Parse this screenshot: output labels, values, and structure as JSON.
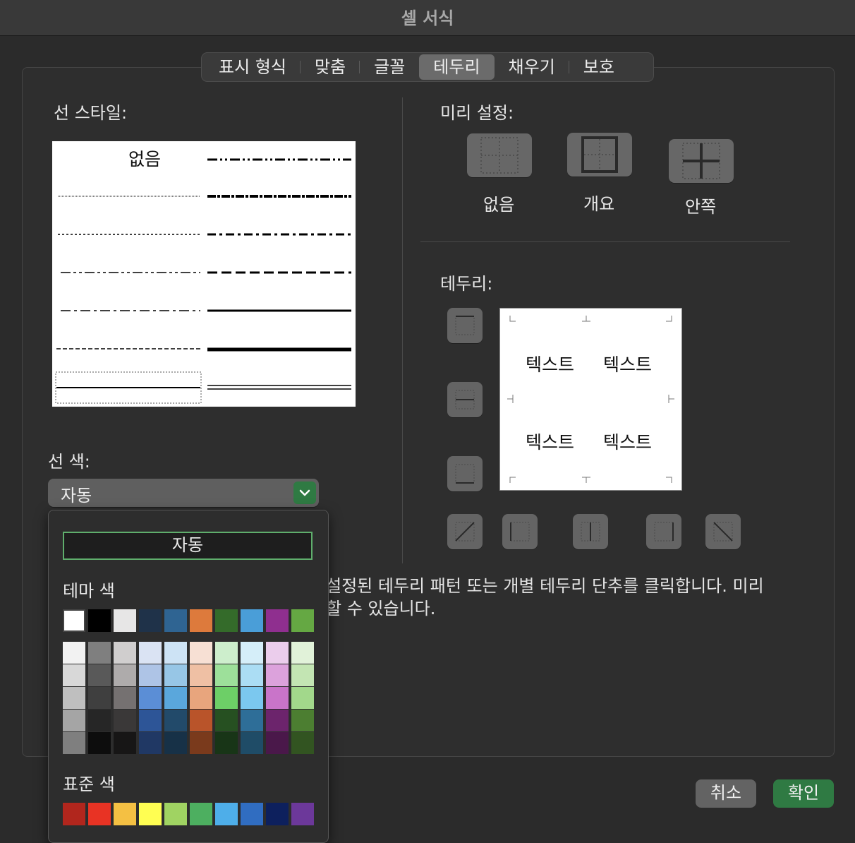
{
  "window": {
    "title": "셀 서식"
  },
  "tabs": [
    {
      "label": "표시 형식"
    },
    {
      "label": "맞춤"
    },
    {
      "label": "글꼴"
    },
    {
      "label": "테두리",
      "active": true
    },
    {
      "label": "채우기"
    },
    {
      "label": "보호"
    }
  ],
  "line_style": {
    "label": "선 스타일:",
    "none_label": "없음",
    "styles": [
      "none",
      "dash-dot-dot-medium",
      "hair",
      "slanted-dash-dot",
      "dotted",
      "dash-dot-medium",
      "dash-dot-dot",
      "dashed-medium",
      "dash-dot",
      "medium",
      "dashed",
      "thick",
      "thin-selected",
      "double"
    ],
    "selected": "thin"
  },
  "presets": {
    "label": "미리 설정:",
    "items": [
      {
        "label": "없음",
        "icon": "no-border-icon"
      },
      {
        "label": "개요",
        "icon": "outline-border-icon"
      },
      {
        "label": "안쪽",
        "icon": "inside-border-icon"
      }
    ]
  },
  "border": {
    "label": "테두리:",
    "preview_text": [
      "텍스트",
      "텍스트",
      "텍스트",
      "텍스트"
    ],
    "side_buttons": [
      "top-border-icon",
      "middle-horizontal-border-icon",
      "bottom-border-icon"
    ],
    "bottom_buttons": [
      "diagonal-up-border-icon",
      "left-border-icon",
      "middle-vertical-border-icon",
      "right-border-icon",
      "diagonal-down-border-icon"
    ]
  },
  "line_color": {
    "label": "선 색:",
    "value": "자동",
    "accent": "#2f7a43"
  },
  "color_popup": {
    "auto_label": "자동",
    "theme_label": "테마 색",
    "standard_label": "표준 색",
    "theme_top": [
      "#ffffff",
      "#000000",
      "#e7e6e6",
      "#1f3249",
      "#2f6492",
      "#dd7a3c",
      "#346b2a",
      "#4a9ed8",
      "#8f2f8f",
      "#65a843"
    ],
    "theme_shades": [
      [
        "#f2f2f2",
        "#d8d8d8",
        "#bfbfbf",
        "#a5a5a5",
        "#7f7f7f"
      ],
      [
        "#7f7f7f",
        "#595959",
        "#3f3f3f",
        "#262626",
        "#0d0d0d"
      ],
      [
        "#d0cece",
        "#aeabab",
        "#757171",
        "#3a3838",
        "#171616"
      ],
      [
        "#dae3f3",
        "#aec4e6",
        "#5b8ed6",
        "#2d5597",
        "#203864"
      ],
      [
        "#cde3f5",
        "#97c6e6",
        "#5aa7dc",
        "#224a6a",
        "#173147"
      ],
      [
        "#f7e0d4",
        "#efc0a4",
        "#e8a57d",
        "#b9542a",
        "#7a3a1c"
      ],
      [
        "#cdeecc",
        "#9de09a",
        "#6dcf67",
        "#265021",
        "#183517"
      ],
      [
        "#d5eef9",
        "#abddf4",
        "#7bc8ef",
        "#2e6e98",
        "#1f4c67"
      ],
      [
        "#ebcdec",
        "#dca2dc",
        "#c974c9",
        "#6c246c",
        "#4a184a"
      ],
      [
        "#e1f2d9",
        "#c3e5b3",
        "#a2d88b",
        "#4c7e31",
        "#325421"
      ]
    ],
    "standard": [
      "#b1261d",
      "#e83324",
      "#f4c043",
      "#fffe52",
      "#a0d362",
      "#4daf60",
      "#4eaee9",
      "#306dc1",
      "#0d205d",
      "#6c389a"
    ]
  },
  "hint": {
    "line1": "설정된 테두리 패턴 또는 개별 테두리 단추를 클릭합니다. 미리",
    "line2": "할 수 있습니다."
  },
  "buttons": {
    "cancel": "취소",
    "ok": "확인"
  }
}
